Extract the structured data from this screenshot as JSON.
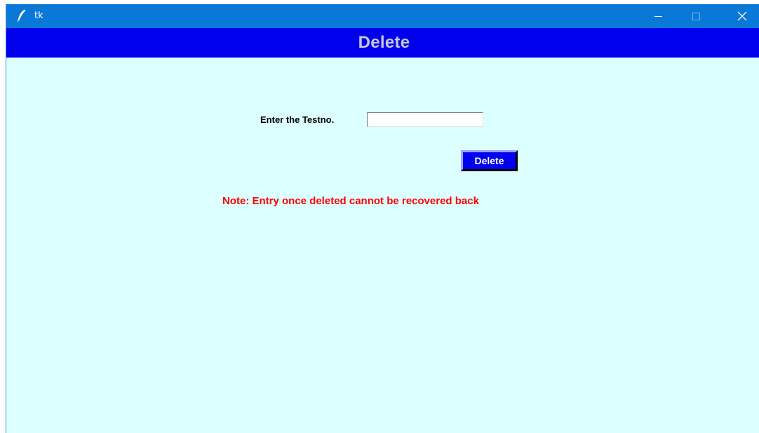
{
  "window": {
    "title": "tk",
    "icon": "tk-feather-icon",
    "controls": {
      "minimize": "minimize-icon",
      "maximize": "maximize-icon",
      "close": "close-icon"
    }
  },
  "header": {
    "title": "Delete"
  },
  "form": {
    "testno_label": "Enter the Testno.",
    "testno_value": "",
    "delete_label": "Delete"
  },
  "note": {
    "text": "Note: Entry once deleted cannot be recovered back"
  },
  "colors": {
    "titlebar": "#0a78d7",
    "header_bar": "#0000ee",
    "header_text": "#c8c8d8",
    "background": "#dcffff",
    "button": "#0000ee",
    "note": "#ff0000"
  }
}
